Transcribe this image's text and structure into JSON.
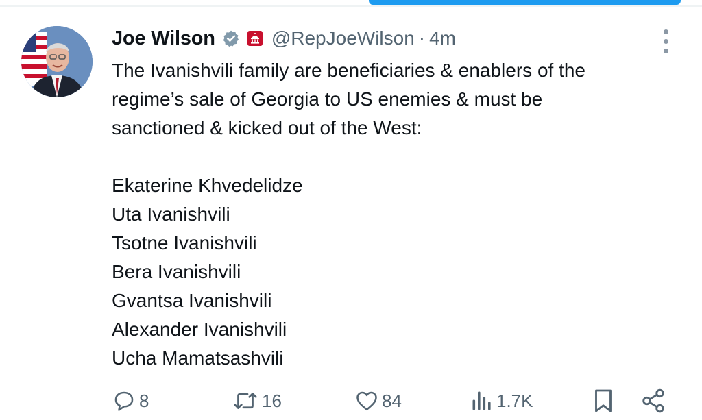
{
  "colors": {
    "accent": "#1d9bf0",
    "text_primary": "#0f1419",
    "text_secondary": "#536471",
    "verified_badge": "#829aab",
    "gov_label": "#c8102e"
  },
  "author": {
    "display_name": "Joe Wilson",
    "handle": "@RepJoeWilson",
    "separator": "·",
    "time_ago": "4m",
    "avatar_icon": "profile-photo",
    "badge_icon": "verified-badge-icon",
    "affiliation_icon": "government-label-icon"
  },
  "tweet": {
    "intro_lines": [
      "The Ivanishvili family are beneficiaries & enablers of the",
      "regime’s sale of Georgia to US enemies & must be",
      "sanctioned & kicked out of the West:"
    ],
    "names": [
      "Ekaterine Khvedelidze",
      "Uta Ivanishvili",
      "Tsotne Ivanishvili",
      "Bera Ivanishvili",
      "Gvantsa Ivanishvili",
      "Alexander Ivanishvili",
      "Ucha Mamatsashvili"
    ]
  },
  "actions": {
    "replies": "8",
    "reposts": "16",
    "likes": "84",
    "views": "1.7K"
  }
}
